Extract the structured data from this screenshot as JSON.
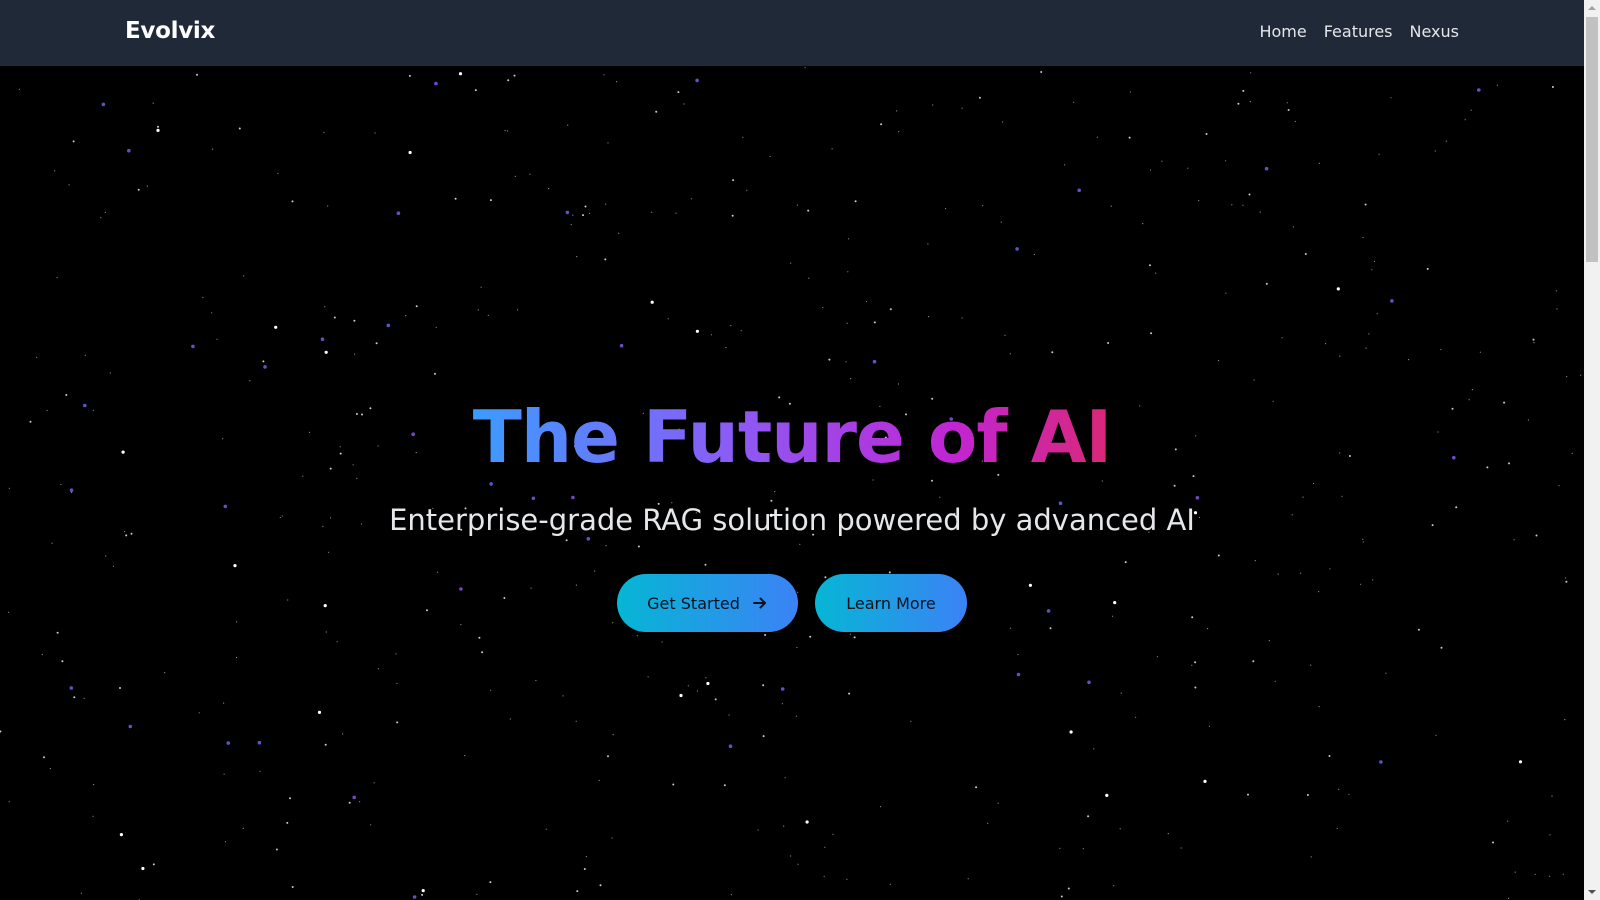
{
  "navbar": {
    "brand": "Evolvix",
    "links": [
      {
        "label": "Home"
      },
      {
        "label": "Features"
      },
      {
        "label": "Nexus"
      }
    ]
  },
  "hero": {
    "title": "The Future of AI",
    "subtitle": "Enterprise-grade RAG solution powered by advanced AI",
    "primary_button": {
      "label": "Get Started",
      "icon": "arrow-right-icon"
    },
    "secondary_button": {
      "label": "Learn More"
    }
  },
  "colors": {
    "nav_background": "#1f2937",
    "page_background": "#000000",
    "title_gradient": [
      "#3b9cff",
      "#8b5cf6",
      "#c026d3",
      "#db2777"
    ],
    "button_gradient": [
      "#06b6d4",
      "#3b82f6"
    ]
  }
}
